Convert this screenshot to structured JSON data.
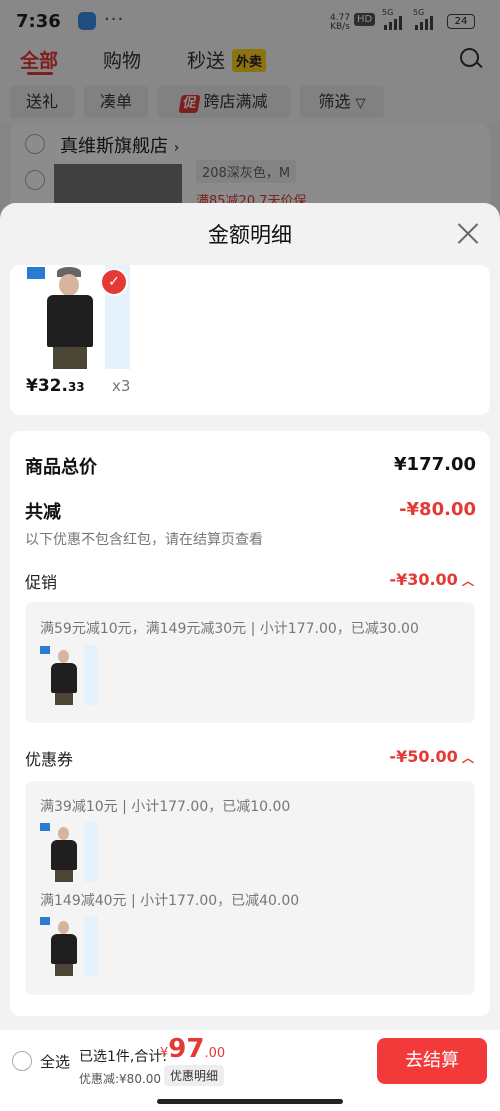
{
  "status_bar": {
    "time": "7:36",
    "dots": "···",
    "net_speed": "4.77",
    "net_unit": "KB/s",
    "hd": "HD",
    "sig1": "5G",
    "sig2": "5G",
    "battery": "24"
  },
  "tabs": [
    {
      "label": "全部"
    },
    {
      "label": "购物"
    },
    {
      "label": "秒送"
    }
  ],
  "tab_badge": "外卖",
  "chips": {
    "gift": "送礼",
    "combine": "凑单",
    "promo_icon": "促",
    "cross_store": "跨店满减",
    "filter": "筛选"
  },
  "background": {
    "shop_name": "真维斯旗舰店",
    "spec": "208深灰色，M",
    "promo": "满85减20  7天价保"
  },
  "sheet": {
    "title": "金额明细",
    "product": {
      "price_int": "¥32.",
      "price_dec": "33",
      "qty": "x3"
    },
    "total_label": "商品总价",
    "total_value": "¥177.00",
    "reduce_label": "共减",
    "reduce_value": "-¥80.00",
    "reduce_note": "以下优惠不包含红包，请在结算页查看",
    "promo_label": "促销",
    "promo_value": "-¥30.00",
    "promo_detail": "满59元减10元，满149元减30元 | 小计177.00，已减30.00",
    "coupon_label": "优惠券",
    "coupon_value": "-¥50.00",
    "coupon_detail_1": "满39减10元 | 小计177.00，已减10.00",
    "coupon_detail_2": "满149减40元 | 小计177.00，已减40.00"
  },
  "bottom": {
    "select_all": "全选",
    "selected": "已选1件,合计:",
    "currency": "¥",
    "amount": "97",
    "amount_dec": ".00",
    "saved": "优惠减:¥80.00",
    "detail": "优惠明细",
    "checkout": "去结算"
  },
  "colors": {
    "accent": "#e53935",
    "checkout": "#f23a3a",
    "badge": "#ffd21f"
  }
}
